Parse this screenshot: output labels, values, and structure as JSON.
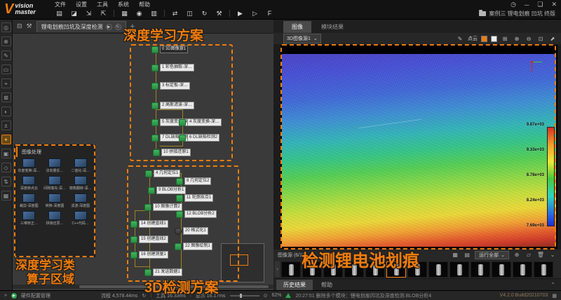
{
  "window": {
    "logo": {
      "v": "V",
      "line1": "vision",
      "line2": "master"
    },
    "menus": [
      "文件",
      "设置",
      "工具",
      "系统",
      "帮助"
    ],
    "controls": {
      "clock": "◷",
      "minimize": "─",
      "restore": "❏",
      "close": "✕"
    },
    "project": "案例三 锂电划痕 凹坑 终版"
  },
  "toolbar": {
    "icons": [
      {
        "name": "save-icon",
        "glyph": "▤"
      },
      {
        "name": "open-folder-icon",
        "glyph": "◪"
      },
      {
        "name": "import-icon",
        "glyph": "⇲"
      },
      {
        "name": "export-icon",
        "glyph": "⇱"
      },
      {
        "name": "window-layout-icon",
        "glyph": "▦"
      },
      {
        "name": "camera-icon",
        "glyph": "◉"
      },
      {
        "name": "parameter-icon",
        "glyph": "▥"
      },
      {
        "name": "communication-icon",
        "glyph": "⇄"
      },
      {
        "name": "io-icon",
        "glyph": "◫"
      },
      {
        "name": "global-loop-icon",
        "glyph": "↻"
      },
      {
        "name": "tool-icon",
        "glyph": "⚒"
      },
      {
        "name": "run-all-icon",
        "glyph": "▶"
      },
      {
        "name": "run-once-icon",
        "glyph": "▷"
      },
      {
        "name": "function-icon",
        "glyph": "F"
      }
    ]
  },
  "rail": {
    "icons": [
      {
        "name": "acquisition-icon",
        "glyph": "◎"
      },
      {
        "name": "location-icon",
        "glyph": "⊕"
      },
      {
        "name": "image-edit-icon",
        "glyph": "✎"
      },
      {
        "name": "region-icon",
        "glyph": "▭"
      },
      {
        "name": "measure-icon",
        "glyph": "⌖"
      },
      {
        "name": "recognition-icon",
        "glyph": "⊠"
      },
      {
        "name": "color-icon",
        "glyph": "◐"
      },
      {
        "name": "calc-icon",
        "glyph": "±"
      },
      {
        "name": "deep-learning-icon",
        "glyph": "✦"
      },
      {
        "name": "chart-icon",
        "glyph": "▣"
      },
      {
        "name": "logic-icon",
        "glyph": "◇"
      },
      {
        "name": "transfer-icon",
        "glyph": "⇅"
      },
      {
        "name": "display-icon",
        "glyph": "▦"
      }
    ]
  },
  "flow": {
    "header_icons": {
      "hierarchy": "⊟",
      "wrench": "⚒"
    },
    "tab": {
      "label": "锂电划痕凹坑及深度检测",
      "run": "▶",
      "loop": "↻"
    },
    "add_tab": "+",
    "dl": {
      "nodes": [
        {
          "label": "0 3D图像源1"
        },
        {
          "label": "1 彩色抽取-深…"
        },
        {
          "label": "3 标定板-深…"
        },
        {
          "label": "2 高斯滤波-深…"
        },
        {
          "label": "5 灰度变换-深…"
        },
        {
          "label": "7 DL缺陷检测1"
        },
        {
          "label": "10 拼接还原1"
        }
      ],
      "branch": [
        {
          "label": "4 灰度变换-深…"
        },
        {
          "label": "6 DL缺陷检测2"
        }
      ]
    },
    "d3": {
      "main": [
        {
          "label": "4 几何定位1"
        },
        {
          "label": "9 BLOB分析1"
        },
        {
          "label": "10 图像计算2"
        },
        {
          "label": "21 发送数据1"
        }
      ],
      "left": [
        {
          "label": "14 创建直线1"
        },
        {
          "label": "15 创建直线2"
        },
        {
          "label": "16 创建测量1"
        }
      ],
      "right": [
        {
          "label": "8 几何定位2"
        },
        {
          "label": "11 轮廓拟合1"
        },
        {
          "label": "12 BLOB分析2"
        },
        {
          "label": "20 格式化1"
        },
        {
          "label": "22 图像绘制1"
        }
      ]
    },
    "ops": {
      "title": "图像处理",
      "items": [
        {
          "label": "灰度变换-深…"
        },
        {
          "label": "法向量反…"
        },
        {
          "label": "二值化-深…"
        },
        {
          "label": "深度转点云"
        },
        {
          "label": "间隙填充-深…"
        },
        {
          "label": "镜像翻转-深…"
        },
        {
          "label": "裁剪-深度图"
        },
        {
          "label": "转换-深度图"
        },
        {
          "label": "滤波-深度图"
        },
        {
          "label": "三维矫正…"
        },
        {
          "label": "拼接还原…"
        },
        {
          "label": "C++代码…"
        }
      ]
    }
  },
  "annotations": {
    "deep_learning": "深度学习方案",
    "detection_3d": "3D检测方案",
    "ops_line1": "深度学习类",
    "ops_line2": "算子区域",
    "detect_scratch": "检测锂电池划痕"
  },
  "right_panel": {
    "tabs": [
      {
        "label": "图像"
      },
      {
        "label": "模块结果"
      }
    ],
    "source_select": "3D图像源1",
    "render_label": "点云",
    "view_icons": {
      "pencil": "✎",
      "fit": "⊞",
      "zoom_in": "⊕",
      "zoom_out": "⊖",
      "one_to_one": "⊡",
      "fullscreen": "⬈"
    },
    "colorbar_labels": [
      "9.87e+03",
      "9.33e+03",
      "8.78e+03",
      "8.24e+03",
      "7.69e+03"
    ],
    "strip": {
      "label": "图像源 (6/12)",
      "grid_icon": "▦",
      "save_icon": "▤",
      "run_all": "运行全部",
      "add_icon": "⊕",
      "folder_icon": "▱",
      "delete_icon": "🗑",
      "chevron": "⌄",
      "prev": "›"
    },
    "result_tabs": [
      {
        "label": "历史结果"
      },
      {
        "label": "帮助"
      }
    ],
    "collapse": "⌃"
  },
  "status": {
    "expand": "»",
    "left_label": "硬件配置管理",
    "flow_time": "流程 4,578.44ms",
    "loop_glyph": "↻",
    "tool_time": "工具 16.33ms",
    "display_time": "显示 16.17ms",
    "zoom_glyph": "⊙",
    "zoom": "62%",
    "log": "20:27:51  删除多个模块：锂电划痕凹坑及深度检测.BLOB分析4",
    "version": "V4.2.0 Build20210703",
    "tray_icon": "▦"
  }
}
